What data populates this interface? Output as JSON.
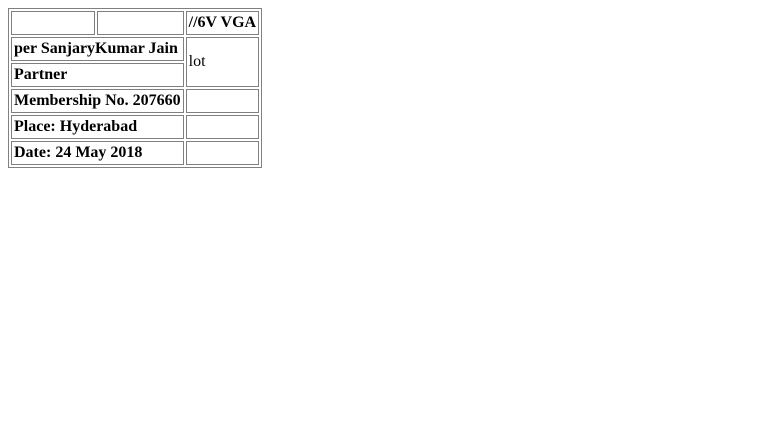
{
  "document": {
    "header": {
      "cell1": "",
      "cell2": "",
      "cell3": "//6V VGA"
    },
    "rows": [
      {
        "left": "per SanjaryKumar Jain"
      },
      {
        "left": "Partner"
      },
      {
        "left": "Membership No. 207660",
        "right": ""
      },
      {
        "left": "Place: Hyderabad",
        "right": ""
      },
      {
        "left": "Date: 24 May 2018",
        "right": ""
      }
    ],
    "merged_right": "lot"
  }
}
